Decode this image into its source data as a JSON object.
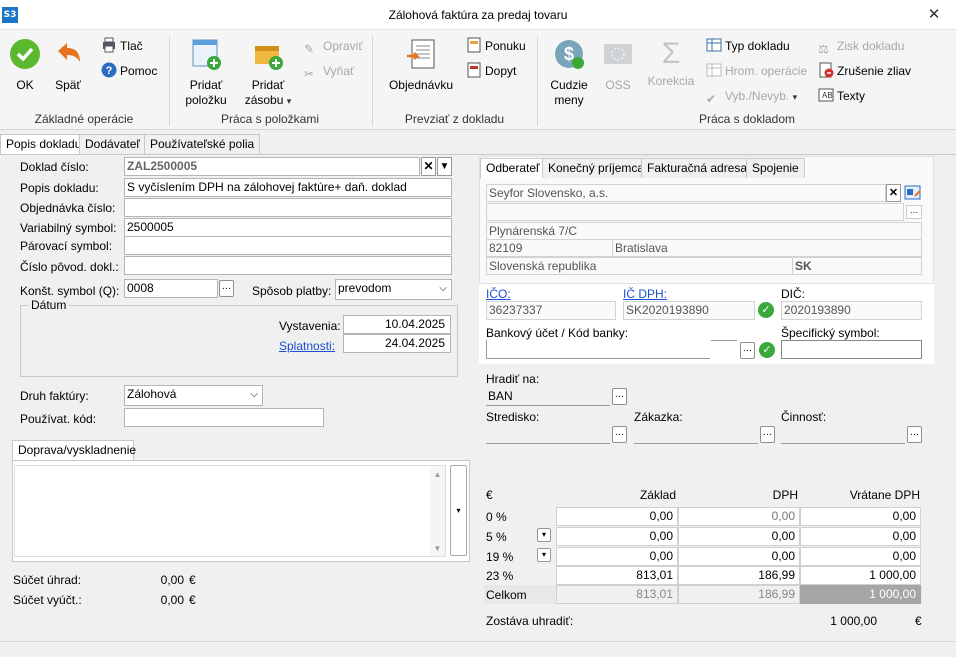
{
  "window": {
    "logo": "S3",
    "title": "Zálohová faktúra za predaj tovaru",
    "close": "✕"
  },
  "ribbon": {
    "ok": "OK",
    "back": "Späť",
    "print": "Tlač",
    "help": "Pomoc",
    "group1": "Základné operácie",
    "add_item_1": "Pridať",
    "add_item_2": "položku",
    "add_stock_1": "Pridať",
    "add_stock_2": "zásobu",
    "fix": "Opraviť",
    "cut": "Vyňať",
    "group2": "Práca s položkami",
    "order": "Objednávku",
    "offer": "Ponuku",
    "delivery": "Dopyt",
    "group3": "Prevziať z dokladu",
    "currency_1": "Cudzie",
    "currency_2": "meny",
    "oss": "OSS",
    "correction": "Korekcia",
    "doctype": "Typ dokladu",
    "bulk": "Hrom. operácie",
    "select": "Vyb./Nevyb.",
    "profit": "Zisk dokladu",
    "cancel_discount": "Zrušenie zliav",
    "texts": "Texty",
    "group4": "Práca s dokladom"
  },
  "tabs": [
    "Popis dokladu",
    "Dodávateľ",
    "Používateľské polia"
  ],
  "form": {
    "doc_no_label": "Doklad číslo:",
    "doc_no": "ZAL2500005",
    "desc_label": "Popis dokladu:",
    "desc": "S vyčíslením DPH na zálohovej faktúre+ daň. doklad",
    "order_label": "Objednávka číslo:",
    "order": "",
    "var_label": "Variabilný symbol:",
    "var": "2500005",
    "pair_label": "Párovací symbol:",
    "pair": "",
    "orig_label": "Číslo pôvod. dokl.:",
    "orig": "",
    "const_label": "Konšt. symbol (Q):",
    "const": "0008",
    "pay_label": "Spôsob platby:",
    "pay": "prevodom",
    "date_group": "Dátum",
    "issue_label": "Vystavenia:",
    "issue": "10.04.2025",
    "due_label": "Splatnosti:",
    "due": "24.04.2025",
    "type_label": "Druh faktúry:",
    "type": "Zálohová",
    "user_code_label": "Používat. kód:",
    "user_code": "",
    "transport_tab": "Doprava/vyskladnenie"
  },
  "partner": {
    "tabs": [
      "Odberateľ",
      "Konečný príjemca",
      "Fakturačná adresa",
      "Spojenie"
    ],
    "name": "Seyfor Slovensko, a.s.",
    "street": "Plynárenská 7/C",
    "zip": "82109",
    "city": "Bratislava",
    "country": "Slovenská republika",
    "country_code": "SK",
    "ico_label": "IČO:",
    "ico": "36237337",
    "icdph_label": "IČ DPH:",
    "icdph": "SK2020193890",
    "dic_label": "DIČ:",
    "dic": "2020193890",
    "bank_label": "Bankový účet / Kód banky:",
    "spec_label": "Špecifický symbol:",
    "pay_to_label": "Hradiť na:",
    "pay_to": "BAN",
    "center_label": "Stredisko:",
    "job_label": "Zákazka:",
    "activity_label": "Činnosť:"
  },
  "vat": {
    "h_currency": "€",
    "h_base": "Základ",
    "h_vat": "DPH",
    "h_total": "Vrátane DPH",
    "rows": [
      {
        "rate": "0 %",
        "base": "0,00",
        "vat": "0,00",
        "total": "0,00"
      },
      {
        "rate": "5 %",
        "base": "0,00",
        "vat": "0,00",
        "total": "0,00"
      },
      {
        "rate": "19 %",
        "base": "0,00",
        "vat": "0,00",
        "total": "0,00"
      },
      {
        "rate": "23 %",
        "base": "813,01",
        "vat": "186,99",
        "total": "1 000,00"
      }
    ],
    "sum_label": "Celkom",
    "sum_base": "813,01",
    "sum_vat": "186,99",
    "sum_total": "1 000,00",
    "remain_label": "Zostáva uhradiť:",
    "remain": "1 000,00",
    "remain_cur": "€"
  },
  "totals": {
    "paid_label": "Súčet úhrad:",
    "paid": "0,00",
    "paid_cur": "€",
    "billed_label": "Súčet vyúčt.:",
    "billed": "0,00",
    "billed_cur": "€"
  }
}
